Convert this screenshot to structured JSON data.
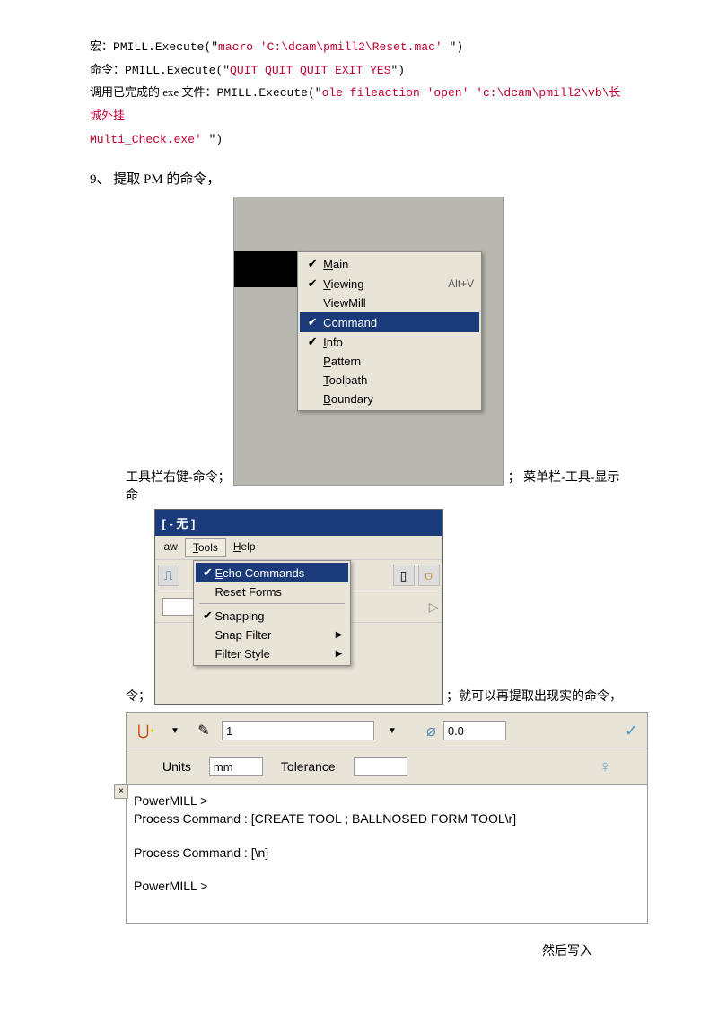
{
  "code": {
    "line1_label": "宏：",
    "line1_a": "PMILL.Execute(",
    "line1_q1": "\"",
    "line1_red": "macro 'C:\\dcam\\pmill2\\Reset.mac' ",
    "line1_q2": "\"",
    "line1_b": ")",
    "line2_label": "命令：",
    "line2_a": "PMILL.Execute(\"",
    "line2_red": "QUIT QUIT QUIT EXIT YES",
    "line2_b": "\")",
    "line3_label": "调用已完成的 exe 文件：",
    "line3_a": "PMILL.Execute(\"",
    "line3_red1": "ole fileaction 'open' 'c:\\dcam\\pmill2\\vb\\长城外挂",
    "line3_red2": "Multi_Check.exe' ",
    "line3_b": "\")"
  },
  "section9": "9、 提取 PM 的命令，",
  "sc1": {
    "pre": "工具栏右键-命令；",
    "post": "；  菜单栏-工具-显示命",
    "items": [
      {
        "chk": "✔",
        "label": "Main",
        "u": "M",
        "rest": "ain",
        "shortcut": ""
      },
      {
        "chk": "✔",
        "label": "Viewing",
        "u": "V",
        "rest": "iewing",
        "shortcut": "Alt+V"
      },
      {
        "chk": "",
        "label": "ViewMill",
        "u": "",
        "rest": "ViewMill",
        "shortcut": ""
      },
      {
        "chk": "✔",
        "label": "Command",
        "u": "C",
        "rest": "ommand",
        "shortcut": "",
        "sel": true
      },
      {
        "chk": "✔",
        "label": "Info",
        "u": "I",
        "rest": "nfo",
        "shortcut": ""
      },
      {
        "chk": "",
        "label": "Pattern",
        "u": "P",
        "rest": "attern",
        "shortcut": ""
      },
      {
        "chk": "",
        "label": "Toolpath",
        "u": "T",
        "rest": "oolpath",
        "shortcut": ""
      },
      {
        "chk": "",
        "label": "Boundary",
        "u": "B",
        "rest": "oundary",
        "shortcut": ""
      }
    ]
  },
  "sc2": {
    "pre": "令；",
    "post": "；就可以再提取出现实的命令，",
    "title": "[ - 无 ]",
    "menus": {
      "m1": "aw",
      "m2": "Tools",
      "m3": "Help"
    },
    "dropdown": [
      {
        "chk": "✔",
        "label": "Echo Commands",
        "sel": true
      },
      {
        "chk": "",
        "label": "Reset Forms"
      },
      {
        "sep": true
      },
      {
        "chk": "✔",
        "label": "Snapping"
      },
      {
        "chk": "",
        "label": "Snap Filter",
        "arrow": true
      },
      {
        "chk": "",
        "label": "Filter Style",
        "arrow": true
      }
    ]
  },
  "sc3": {
    "num": "1",
    "val": "0.0",
    "units_lbl": "Units",
    "units_val": "mm",
    "tol_lbl": "Tolerance",
    "tol_val": "",
    "console": {
      "p1": "PowerMILL >",
      "p2": "Process Command : [CREATE TOOL ; BALLNOSED FORM TOOL\\r]",
      "p3": "Process Command : [\\n]",
      "p4": "PowerMILL >"
    }
  },
  "trail": "然后写入"
}
